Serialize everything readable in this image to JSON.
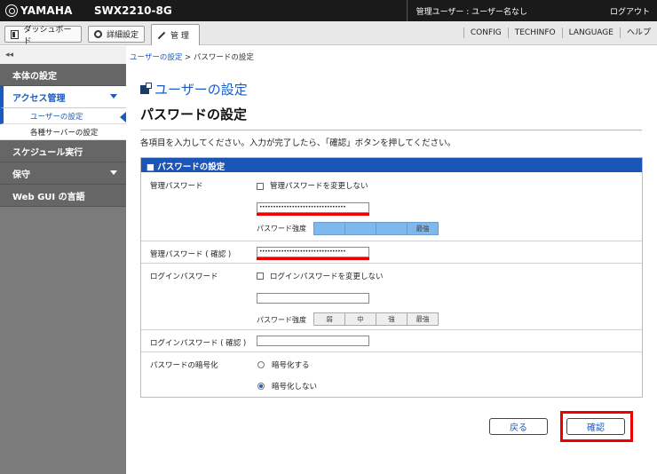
{
  "top": {
    "brand": "YAMAHA",
    "model": "SWX2210-8G",
    "user": "管理ユーザー : ユーザー名なし",
    "logout": "ログアウト"
  },
  "nav": {
    "dashboard": "ダッシュボード",
    "detail": "詳細設定",
    "manage": "管 理",
    "config": "CONFIG",
    "techinfo": "TECHINFO",
    "language": "LANGUAGE",
    "help": "ヘルプ"
  },
  "sidebar": {
    "collapse": "◂◂",
    "main_settings": "本体の設定",
    "access": "アクセス管理",
    "user_settings": "ユーザーの設定",
    "server_settings": "各種サーバーの設定",
    "schedule": "スケジュール実行",
    "maintenance": "保守",
    "webgui_lang": "Web GUI の言語"
  },
  "breadcrumb": {
    "link": "ユーザーの設定",
    "sep": " > ",
    "current": "パスワードの設定"
  },
  "page": {
    "section_title": "ユーザーの設定",
    "title": "パスワードの設定",
    "description": "各項目を入力してください。入力が完了したら、「確認」ボタンを押してください。"
  },
  "panel": {
    "header": "■ パスワードの設定",
    "admin_pw_label": "管理パスワード",
    "admin_nochange": "管理パスワードを変更しない",
    "admin_pw_value": "••••••••••••••••••••••••••••••••",
    "strength_label": "パスワード強度",
    "admin_strength": [
      "",
      "",
      "",
      "最強"
    ],
    "admin_pw_confirm_label": "管理パスワード ( 確認 )",
    "admin_pw_confirm_value": "••••••••••••••••••••••••••••••••",
    "login_pw_label": "ログインパスワード",
    "login_nochange": "ログインパスワードを変更しない",
    "login_pw_value": "",
    "login_strength": [
      "弱",
      "中",
      "強",
      "最強"
    ],
    "login_pw_confirm_label": "ログインパスワード ( 確認 )",
    "login_pw_confirm_value": "",
    "encrypt_label": "パスワードの暗号化",
    "encrypt_yes": "暗号化する",
    "encrypt_no": "暗号化しない"
  },
  "buttons": {
    "back": "戻る",
    "confirm": "確認"
  }
}
